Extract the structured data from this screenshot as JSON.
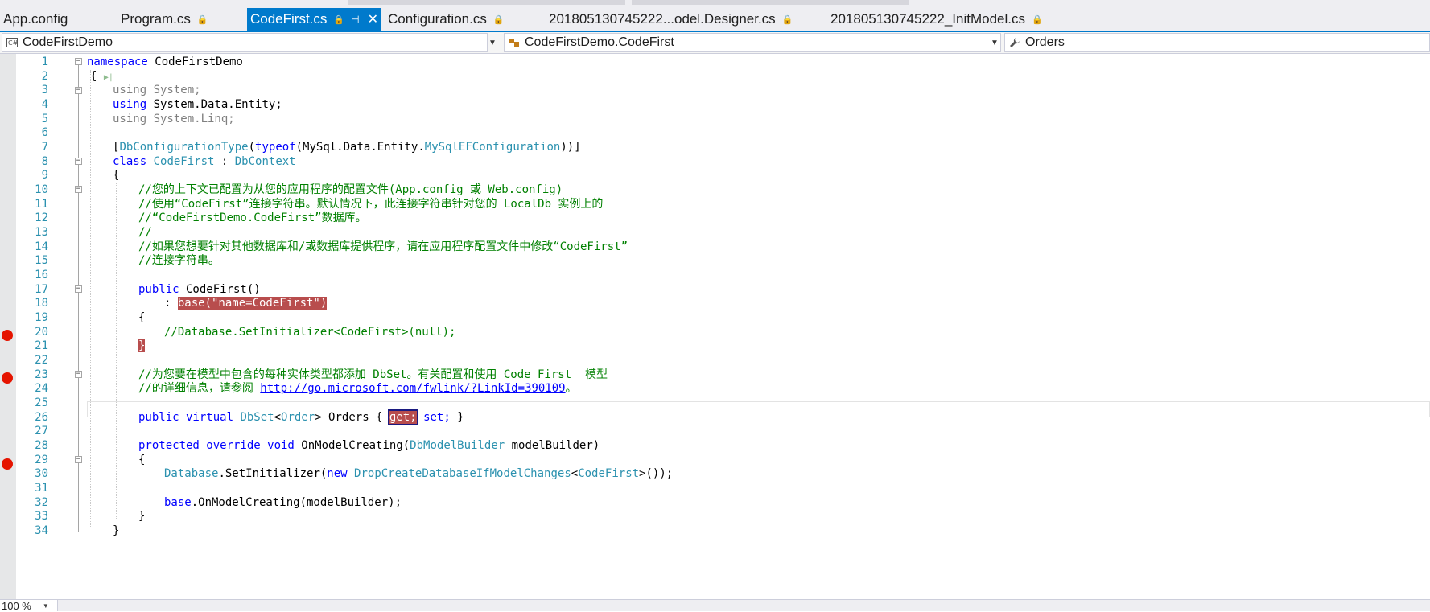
{
  "tabs": [
    {
      "label": "App.config",
      "pinned": false,
      "active": false
    },
    {
      "label": "Program.cs",
      "pinned": true,
      "active": false
    },
    {
      "label": "CodeFirst.cs",
      "pinned": true,
      "active": true
    },
    {
      "label": "Configuration.cs",
      "pinned": true,
      "active": false
    },
    {
      "label": "201805130745222...odel.Designer.cs",
      "pinned": true,
      "active": false
    },
    {
      "label": "201805130745222_InitModel.cs",
      "pinned": true,
      "active": false
    }
  ],
  "tab_icons": {
    "lock": "🔒",
    "pin": "⊣",
    "close": "✕"
  },
  "navbar": {
    "project": "CodeFirstDemo",
    "type": "CodeFirstDemo.CodeFirst",
    "member": "Orders"
  },
  "editor": {
    "line_numbers": [
      "1",
      "2",
      "3",
      "4",
      "5",
      "6",
      "7",
      "8",
      "9",
      "10",
      "11",
      "12",
      "13",
      "14",
      "15",
      "16",
      "17",
      "18",
      "19",
      "20",
      "21",
      "22",
      "23",
      "24",
      "25",
      "26",
      "27",
      "28",
      "29",
      "30",
      "31",
      "32",
      "33",
      "34"
    ],
    "code": {
      "l1_kw": "namespace",
      "l1_name": " CodeFirstDemo",
      "l2": "{",
      "l3": "using System;",
      "l4_kw": "using",
      "l4_rest": " System.Data.Entity;",
      "l5": "using System.Linq;",
      "l7_a": "[",
      "l7_attr": "DbConfigurationType",
      "l7_b": "(",
      "l7_kw": "typeof",
      "l7_c": "(MySql.Data.Entity.",
      "l7_ty": "MySqlEFConfiguration",
      "l7_d": "))]",
      "l8_kw": "class",
      "l8_sp": " ",
      "l8_name": "CodeFirst",
      "l8_colon": " : ",
      "l8_base": "DbContext",
      "l9": "{",
      "l10": "//您的上下文已配置为从您的应用程序的配置文件(App.config 或 Web.config)",
      "l11": "//使用“CodeFirst”连接字符串。默认情况下，此连接字符串针对您的 LocalDb 实例上的",
      "l12": "//“CodeFirstDemo.CodeFirst”数据库。",
      "l13": "//",
      "l14": "//如果您想要针对其他数据库和/或数据库提供程序，请在应用程序配置文件中修改“CodeFirst”",
      "l15": "//连接字符串。",
      "l17_kw": "public",
      "l17_rest": " CodeFirst()",
      "l18_pre": ": ",
      "l18_hl": "base(\"name=CodeFirst\")",
      "l19": "{",
      "l20": "//Database.SetInitializer<CodeFirst>(null);",
      "l21": "}",
      "l23": "//为您要在模型中包含的每种实体类型都添加 DbSet。有关配置和使用 Code First  模型",
      "l24_a": "//的详细信息，请参阅 ",
      "l24_link": "http://go.microsoft.com/fwlink/?LinkId=390109",
      "l24_b": "。",
      "l26_kw": "public virtual",
      "l26_sp": " ",
      "l26_ty": "DbSet",
      "l26_lt": "<",
      "l26_ty2": "Order",
      "l26_gt": "> Orders { ",
      "l26_get": "get;",
      "l26_sp2": " ",
      "l26_set": "set;",
      "l26_end": " }",
      "l28_kw": "protected override void",
      "l28_a": " OnModelCreating(",
      "l28_ty": "DbModelBuilder",
      "l28_b": " modelBuilder)",
      "l29": "{",
      "l30_ty": "Database",
      "l30_a": ".SetInitializer(",
      "l30_kw": "new",
      "l30_sp": " ",
      "l30_ty2": "DropCreateDatabaseIfModelChanges",
      "l30_lt": "<",
      "l30_ty3": "CodeFirst",
      "l30_b": ">());",
      "l32_kw": "base",
      "l32_rest": ".OnModelCreating(modelBuilder);",
      "l33": "}",
      "l34": "}"
    }
  },
  "zoom": "100 %",
  "colors": {
    "accent": "#007acc",
    "breakpoint": "#e51400",
    "keyword": "#0000ff",
    "type": "#2b91af",
    "comment": "#008000"
  }
}
